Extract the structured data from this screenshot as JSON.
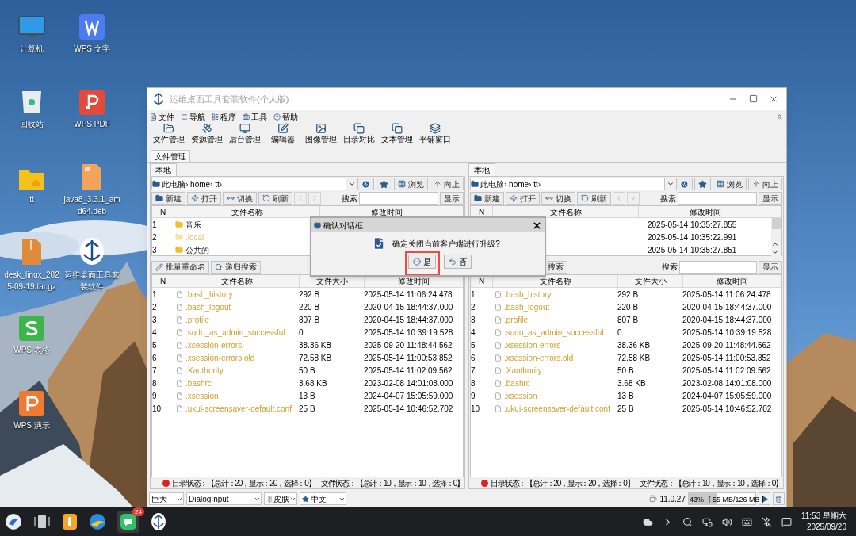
{
  "desktop_icons": [
    {
      "label": "计算机",
      "kind": "computer"
    },
    {
      "label": "回收站",
      "kind": "trash"
    },
    {
      "label": "tt",
      "kind": "folder"
    },
    {
      "label": "desk_linux_2025-09-19.tar.gz",
      "kind": "archive"
    },
    {
      "label": "WPS 表格",
      "kind": "spreadsheet"
    },
    {
      "label": "WPS 演示",
      "kind": "presentation"
    },
    {
      "label": "WPS 文字",
      "kind": "document"
    },
    {
      "label": "WPS PDF",
      "kind": "pdf"
    },
    {
      "label": "java8_3.3.1_amd64.deb",
      "kind": "package"
    },
    {
      "label": "运维桌面工具套装软件",
      "kind": "app"
    }
  ],
  "window": {
    "title": "运维桌面工具套装软件(个人版)"
  },
  "menu": [
    "文件",
    "导航",
    "程序",
    "工具",
    "帮助"
  ],
  "toolbar": [
    "文件管理",
    "资源管理",
    "后台管理",
    "编辑器",
    "图像管理",
    "目录对比",
    "文本管理",
    "平铺窗口"
  ],
  "tabs": [
    {
      "label": "文件管理",
      "selected": true
    }
  ],
  "panels": [
    {
      "tabs": [
        {
          "label": "本地",
          "selected": true
        }
      ],
      "path": "此电脑› home› tt›",
      "path_buttons": [
        "浏览",
        "向上"
      ],
      "actions": [
        "新建",
        "打开",
        "切换",
        "刷新"
      ],
      "nav": [
        {
          "disabled": true
        },
        {
          "disabled": true
        }
      ],
      "search_label": "搜索",
      "search_button": "显示",
      "dir_columns": [
        "N",
        "文件名称",
        "修改时间"
      ],
      "dir_rows": [
        {
          "n": "1",
          "name": "音乐",
          "hidden": false
        },
        {
          "n": "2",
          "name": ".local",
          "hidden": true
        },
        {
          "n": "3",
          "name": "公共的",
          "hidden": false
        }
      ],
      "file_actions": [
        {
          "label": "批量重命名",
          "kind": "rename"
        },
        {
          "label": "递归搜索",
          "kind": "search"
        }
      ],
      "file_columns": [
        "N",
        "文件名称",
        "文件大小",
        "修改时间"
      ],
      "file_rows": [
        {
          "n": "1",
          "name": ".bash_history",
          "size": "292 B",
          "time": "2025-05-14 11:06:24.478"
        },
        {
          "n": "2",
          "name": ".bash_logout",
          "size": "220 B",
          "time": "2020-04-15 18:44:37.000"
        },
        {
          "n": "3",
          "name": ".profile",
          "size": "807 B",
          "time": "2020-04-15 18:44:37.000"
        },
        {
          "n": "4",
          "name": ".sudo_as_admin_successful",
          "size": "0",
          "time": "2025-05-14 10:39:19.528"
        },
        {
          "n": "5",
          "name": ".xsession-errors",
          "size": "38.36 KB",
          "time": "2025-09-20 11:48:44.562"
        },
        {
          "n": "6",
          "name": ".xsession-errors.old",
          "size": "72.58 KB",
          "time": "2025-05-14 11:00:53.852"
        },
        {
          "n": "7",
          "name": ".Xauthority",
          "size": "50 B",
          "time": "2025-05-14 11:02:09.562"
        },
        {
          "n": "8",
          "name": ".bashrc",
          "size": "3.68 KB",
          "time": "2023-02-08 14:01:08.000"
        },
        {
          "n": "9",
          "name": ".xsession",
          "size": "13 B",
          "time": "2024-04-07 15:05:59.000"
        },
        {
          "n": "10",
          "name": ".ukui-screensaver-default.conf",
          "size": "25 B",
          "time": "2025-05-14 10:46:52.702"
        }
      ],
      "status": "目录状态：【总计：20，显示：20，选择：0】 -- 文件状态：【总计：10，显示：10，选择：0】"
    },
    {
      "tabs": [
        {
          "label": "本地",
          "selected": true
        }
      ],
      "path": "此电脑› home› tt›",
      "path_buttons": [
        "浏览",
        "向上"
      ],
      "actions": [
        "新建",
        "打开",
        "切换",
        "刷新"
      ],
      "nav": [
        {
          "disabled": true
        },
        {
          "disabled": true
        }
      ],
      "search_label": "搜索",
      "search_button": "显示",
      "dir_columns": [
        "N",
        "文件名称",
        "修改时间"
      ],
      "dir_rows": [
        {
          "time": "2025-05-14 10:35:27.855"
        },
        {
          "time": "2025-05-14 10:35:22.991"
        },
        {
          "time": "2025-05-14 10:35:27.851"
        }
      ],
      "file_actions": [
        {
          "label": "搜索",
          "kind": "cut"
        }
      ],
      "file_search_label": "搜索",
      "file_search_button": "显示",
      "file_columns": [
        "N",
        "文件名称",
        "文件大小",
        "修改时间"
      ],
      "file_rows": [
        {
          "n": "1",
          "name": ".bash_history",
          "size": "292 B",
          "time": "2025-05-14 11:06:24.478"
        },
        {
          "n": "2",
          "name": ".bash_logout",
          "size": "220 B",
          "time": "2020-04-15 18:44:37.000"
        },
        {
          "n": "3",
          "name": ".profile",
          "size": "807 B",
          "time": "2020-04-15 18:44:37.000"
        },
        {
          "n": "4",
          "name": ".sudo_as_admin_successful",
          "size": "0",
          "time": "2025-05-14 10:39:19.528"
        },
        {
          "n": "5",
          "name": ".xsession-errors",
          "size": "38.36 KB",
          "time": "2025-09-20 11:48:44.562"
        },
        {
          "n": "6",
          "name": ".xsession-errors.old",
          "size": "72.58 KB",
          "time": "2025-05-14 11:00:53.852"
        },
        {
          "n": "7",
          "name": ".Xauthority",
          "size": "50 B",
          "time": "2025-05-14 11:02:09.562"
        },
        {
          "n": "8",
          "name": ".bashrc",
          "size": "3.68 KB",
          "time": "2023-02-08 14:01:08.000"
        },
        {
          "n": "9",
          "name": ".xsession",
          "size": "13 B",
          "time": "2024-04-07 15:05:59.000"
        },
        {
          "n": "10",
          "name": ".ukui-screensaver-default.conf",
          "size": "25 B",
          "time": "2025-05-14 10:46:52.702"
        }
      ],
      "status": "目录状态：【总计：20，显示：20，选择：0】 -- 文件状态：【总计：10，显示：10，选择：0】"
    }
  ],
  "dialog": {
    "title": "确认对话框",
    "message": "确定关闭当前客户端进行升级?",
    "buttons": [
      {
        "label": "是",
        "kind": "yes",
        "highlighted": true
      },
      {
        "label": "否",
        "kind": "no",
        "highlighted": false
      }
    ]
  },
  "bottom_bar": {
    "font_size": "巨大",
    "font": "DialogInput",
    "theme": "皮肤",
    "language": "中文",
    "java_version": "11.0.27",
    "memory": {
      "text": "43%--[ 55 MB/126 MB ]",
      "level": 0.43
    }
  },
  "taskbar": {
    "badge": "24",
    "time": "11:53 星期六",
    "date": "2025/09/20"
  }
}
